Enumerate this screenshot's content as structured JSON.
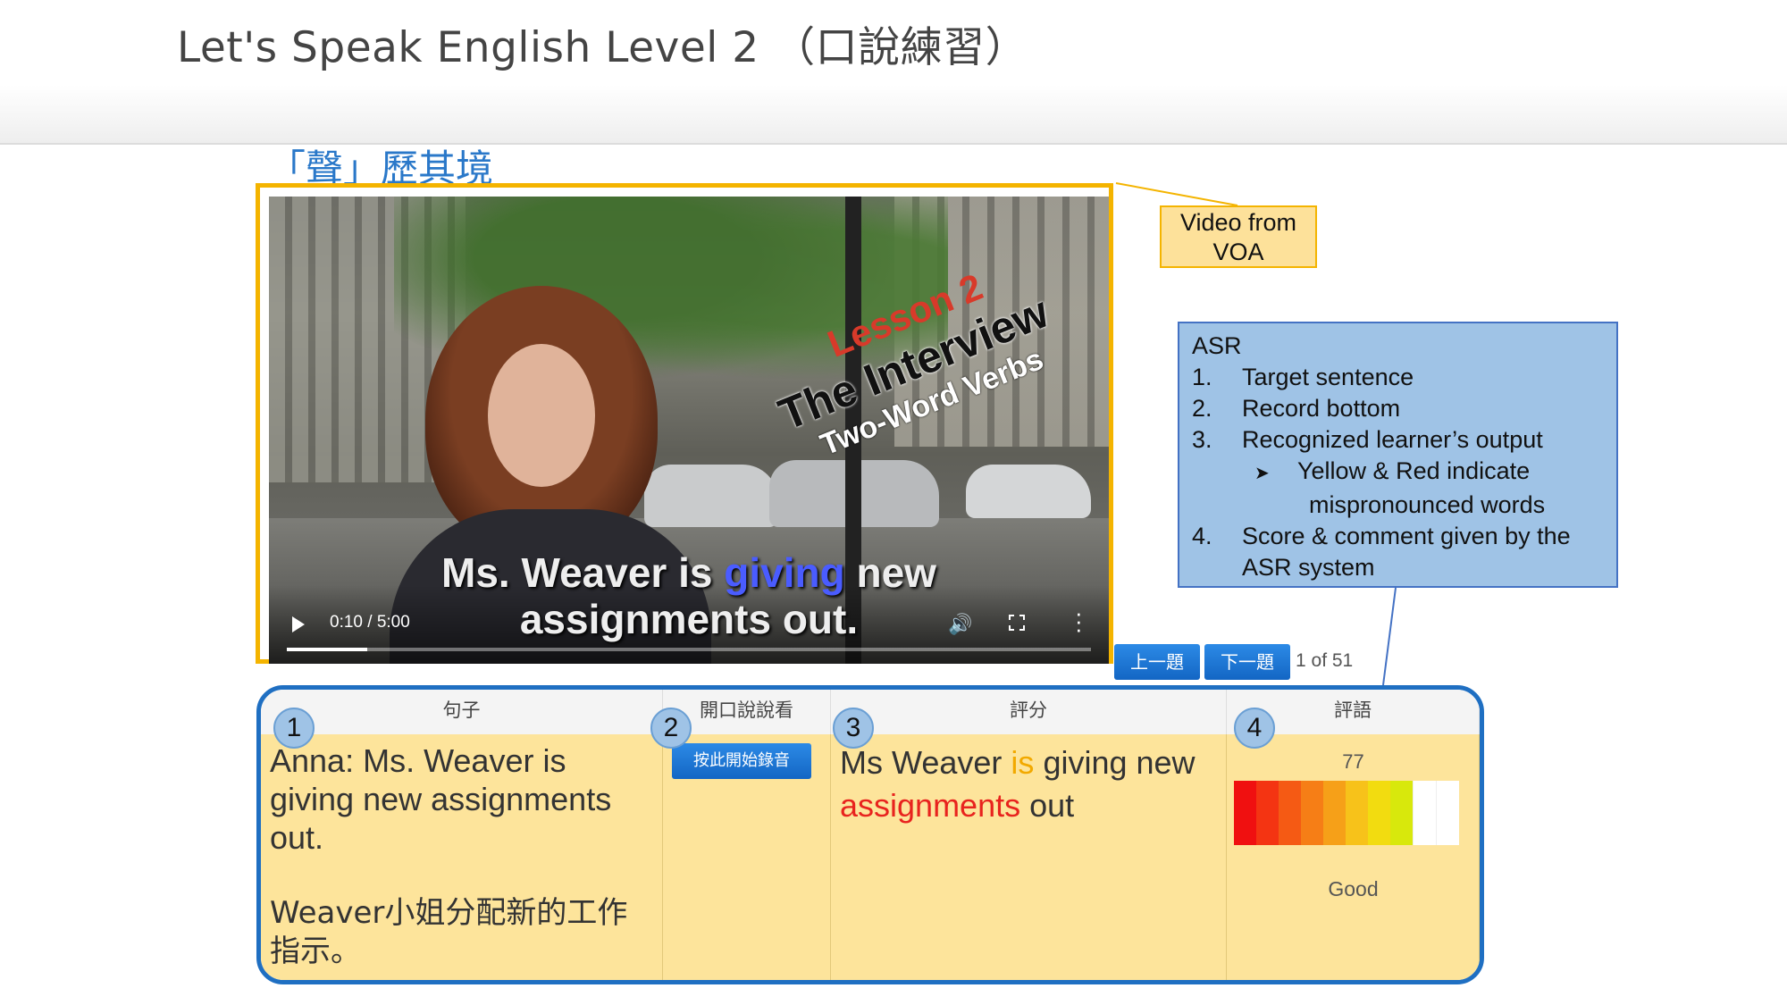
{
  "header": {
    "title": "Let's Speak English Level 2 （口說練習）"
  },
  "section_title": "「聲」歷其境",
  "video": {
    "lesson_line1": "Lesson 2",
    "lesson_line2": "The Interview",
    "lesson_line3": "Two-Word Verbs",
    "caption_before": "Ms. Weaver is ",
    "caption_highlight": "giving",
    "caption_after": " new",
    "caption_line2": "assignments out.",
    "time": "0:10 / 5:00",
    "progress": 0.1,
    "icons": [
      "play-icon",
      "volume-icon",
      "fullscreen-icon",
      "more-icon"
    ]
  },
  "annotations": {
    "voa_label": "Video from VOA",
    "asr": {
      "title": "ASR",
      "items": [
        {
          "num": "1.",
          "text": "Target sentence"
        },
        {
          "num": "2.",
          "text": "Record bottom"
        },
        {
          "num": "3.",
          "text": "Recognized learner’s output"
        }
      ],
      "sub_line1": "Yellow & Red indicate",
      "sub_line2": "mispronounced words",
      "item4_num": "4.",
      "item4_line1": "Score & comment given by the",
      "item4_line2": "ASR system"
    }
  },
  "nav": {
    "prev_label": "上一題",
    "next_label": "下一題",
    "page_count": "1 of 51"
  },
  "table": {
    "columns": [
      {
        "badge": "1",
        "header": "句子"
      },
      {
        "badge": "2",
        "header": "開口說說看"
      },
      {
        "badge": "3",
        "header": "評分"
      },
      {
        "badge": "4",
        "header": "評語"
      }
    ],
    "sentence_en": "Anna: Ms. Weaver is giving new assignments out.",
    "sentence_zh": "Weaver小姐分配新的工作指示。",
    "record_button": "按此開始錄音",
    "recognized": [
      {
        "word": "Ms",
        "status": "ok"
      },
      {
        "word": "Weaver",
        "status": "ok"
      },
      {
        "word": "is",
        "status": "yellow"
      },
      {
        "word": "giving",
        "status": "ok"
      },
      {
        "word": "new",
        "status": "ok"
      },
      {
        "word": "assignments",
        "status": "red"
      },
      {
        "word": "out",
        "status": "ok"
      }
    ],
    "score": "77",
    "score_fill": 0.77,
    "comment": "Good",
    "colors": {
      "yellow": "#f2a900",
      "red": "#e8231e"
    }
  }
}
